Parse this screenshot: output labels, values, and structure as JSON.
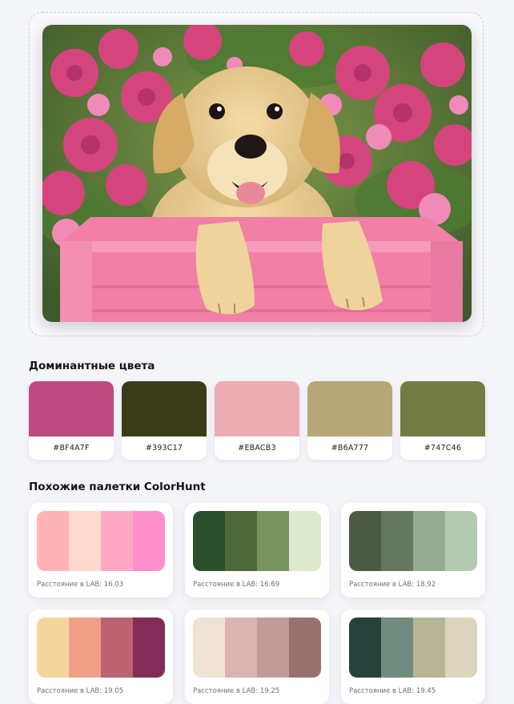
{
  "upload": {
    "image_alt": "Yellow labrador puppy in a pink wooden box among pink flowers"
  },
  "dominant": {
    "title": "Доминантные цвета",
    "colors": [
      {
        "hex": "#BF4A7F",
        "label": "#BF4A7F"
      },
      {
        "hex": "#393C17",
        "label": "#393C17"
      },
      {
        "hex": "#EBACB3",
        "label": "#EBACB3"
      },
      {
        "hex": "#B6A777",
        "label": "#B6A777"
      },
      {
        "hex": "#747C46",
        "label": "#747C46"
      }
    ]
  },
  "similar": {
    "title": "Похожие палетки ColorHunt",
    "palettes": [
      {
        "colors": [
          "#FFB3B5",
          "#FFD8CF",
          "#FFA8C5",
          "#FF8FCD"
        ],
        "distance": "Расстояние в LAB: 16.03"
      },
      {
        "colors": [
          "#2B4E2B",
          "#4E6738",
          "#789560",
          "#DBE8CB"
        ],
        "distance": "Расстояние в LAB: 16.69"
      },
      {
        "colors": [
          "#4C5A44",
          "#65775C",
          "#93AC8F",
          "#B2CBAE"
        ],
        "distance": "Расстояние в LAB: 18.92"
      },
      {
        "colors": [
          "#F5D69F",
          "#F0A089",
          "#BC6272",
          "#832C58"
        ],
        "distance": "Расстояние в LAB: 19.05"
      },
      {
        "colors": [
          "#F0E3D3",
          "#DCB3B3",
          "#C39B99",
          "#9A7171"
        ],
        "distance": "Расстояние в LAB: 19.25"
      },
      {
        "colors": [
          "#26423A",
          "#6F8C7F",
          "#B6B697",
          "#DDD4BE"
        ],
        "distance": "Расстояние в LAB: 19.45"
      }
    ]
  }
}
